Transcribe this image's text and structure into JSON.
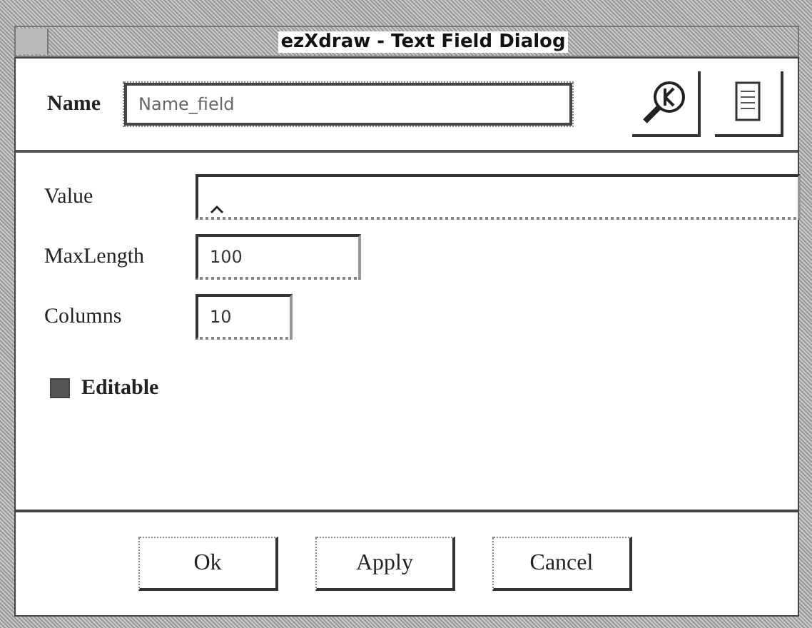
{
  "window": {
    "title": "ezXdraw - Text Field Dialog"
  },
  "name_field": {
    "label": "Name",
    "value": "Name_field"
  },
  "fields": [
    {
      "label": "Value",
      "kind": "wide"
    },
    {
      "label": "MaxLength",
      "value": "100",
      "kind": "medium"
    },
    {
      "label": "Columns",
      "value": "10",
      "kind": "short"
    }
  ],
  "editable": {
    "label": "Editable",
    "checked": true
  },
  "buttons": [
    "Ok",
    "Apply",
    "Cancel"
  ]
}
